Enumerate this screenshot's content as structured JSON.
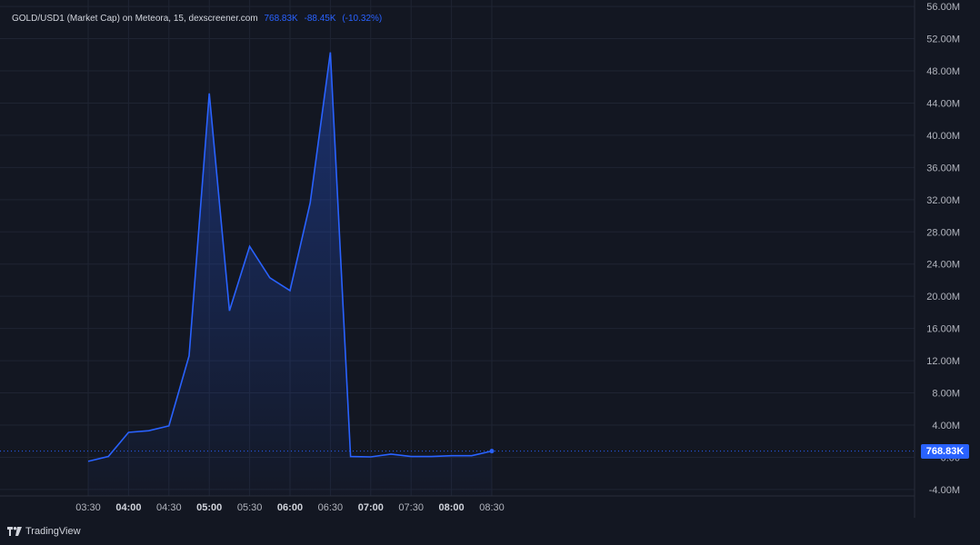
{
  "header": {
    "symbol": "GOLD/USD1 (Market Cap) on Meteora, 15, dexscreener.com",
    "last": "768.83K",
    "change": "-88.45K",
    "change_pct": "(-10.32%)"
  },
  "price_tag": "768.83K",
  "brand": "TradingView",
  "colors": {
    "background": "#131722",
    "line": "#2962ff",
    "grid": "#1f2433",
    "text": "#b2b5be"
  },
  "chart_data": {
    "type": "area",
    "title": "",
    "xlabel": "",
    "ylabel": "",
    "x": [
      "03:30",
      "03:45",
      "04:00",
      "04:15",
      "04:30",
      "04:45",
      "05:00",
      "05:15",
      "05:30",
      "05:45",
      "06:00",
      "06:15",
      "06:30",
      "06:45",
      "07:00",
      "07:15",
      "07:30",
      "07:45",
      "08:00",
      "08:15",
      "08:30"
    ],
    "series": [
      {
        "values": [
          -0.5,
          0.1,
          3.1,
          3.3,
          3.9,
          12.6,
          45.2,
          18.2,
          26.2,
          22.3,
          20.7,
          31.6,
          50.3,
          0.1,
          0.05,
          0.4,
          0.1,
          0.1,
          0.2,
          0.2,
          0.77
        ]
      }
    ],
    "ylim": [
      -4.8,
      56.8
    ],
    "y_ticks": [
      "-4.00M",
      "0.00",
      "4.00M",
      "8.00M",
      "12.00M",
      "16.00M",
      "20.00M",
      "24.00M",
      "28.00M",
      "32.00M",
      "36.00M",
      "40.00M",
      "44.00M",
      "48.00M",
      "52.00M",
      "56.00M"
    ],
    "y_tick_values": [
      -4,
      0,
      4,
      8,
      12,
      16,
      20,
      24,
      28,
      32,
      36,
      40,
      44,
      48,
      52,
      56
    ],
    "x_ticks": [
      {
        "label": "03:30",
        "bold": false
      },
      {
        "label": "04:00",
        "bold": true
      },
      {
        "label": "04:30",
        "bold": false
      },
      {
        "label": "05:00",
        "bold": true
      },
      {
        "label": "05:30",
        "bold": false
      },
      {
        "label": "06:00",
        "bold": true
      },
      {
        "label": "06:30",
        "bold": false
      },
      {
        "label": "07:00",
        "bold": true
      },
      {
        "label": "07:30",
        "bold": false
      },
      {
        "label": "08:00",
        "bold": true
      },
      {
        "label": "08:30",
        "bold": false
      }
    ],
    "last_value": 0.77,
    "grid": true
  }
}
